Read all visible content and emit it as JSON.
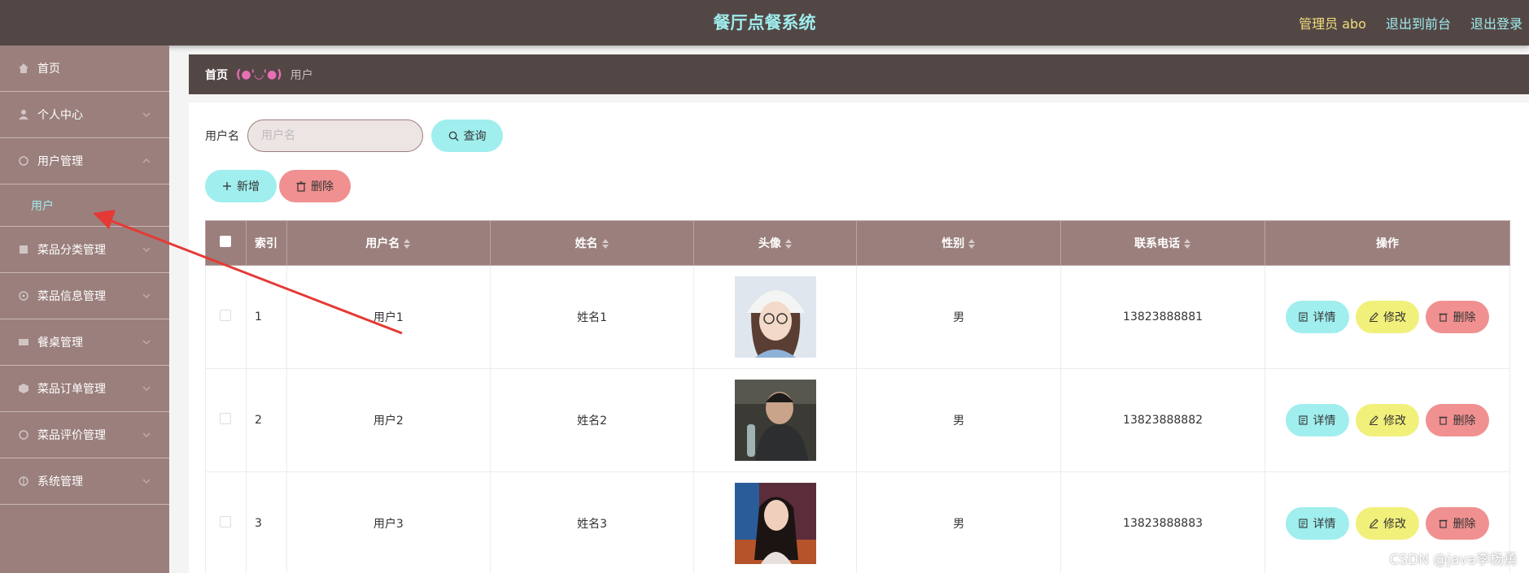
{
  "header": {
    "title": "餐厅点餐系统",
    "admin_label": "管理员 abo",
    "back_to_front": "退出到前台",
    "logout": "退出登录"
  },
  "sidebar": {
    "items": [
      {
        "label": "首页",
        "icon": "home-icon"
      },
      {
        "label": "个人中心",
        "icon": "user-icon"
      },
      {
        "label": "用户管理",
        "icon": "users-icon"
      },
      {
        "label": "用户",
        "icon": ""
      },
      {
        "label": "菜品分类管理",
        "icon": "category-icon"
      },
      {
        "label": "菜品信息管理",
        "icon": "dish-icon"
      },
      {
        "label": "餐桌管理",
        "icon": "table-icon"
      },
      {
        "label": "菜品订单管理",
        "icon": "order-icon"
      },
      {
        "label": "菜品评价管理",
        "icon": "review-icon"
      },
      {
        "label": "系统管理",
        "icon": "settings-icon"
      }
    ]
  },
  "breadcrumb": {
    "home": "首页",
    "separator": "(●'◡'●)",
    "current": "用户"
  },
  "search": {
    "label": "用户名",
    "placeholder": "用户名",
    "button": "查询"
  },
  "actions": {
    "add": "新增",
    "delete": "删除"
  },
  "table": {
    "columns": [
      "索引",
      "用户名",
      "姓名",
      "头像",
      "性别",
      "联系电话",
      "操作"
    ],
    "rows": [
      {
        "index": "1",
        "username": "用户1",
        "name": "姓名1",
        "gender": "男",
        "phone": "13823888881"
      },
      {
        "index": "2",
        "username": "用户2",
        "name": "姓名2",
        "gender": "男",
        "phone": "13823888882"
      },
      {
        "index": "3",
        "username": "用户3",
        "name": "姓名3",
        "gender": "男",
        "phone": "13823888883"
      }
    ],
    "row_actions": {
      "detail": "详情",
      "edit": "修改",
      "delete": "删除"
    }
  },
  "watermark": "CSDN @java李杨勇",
  "colors": {
    "header_bg": "#534746",
    "sidebar_bg": "#9a7f7c",
    "accent_cyan": "#a0eeee",
    "accent_pink": "#f09090",
    "accent_yellow": "#f1f07a",
    "admin_text": "#f1de7c",
    "annotation_arrow": "#e53935"
  }
}
